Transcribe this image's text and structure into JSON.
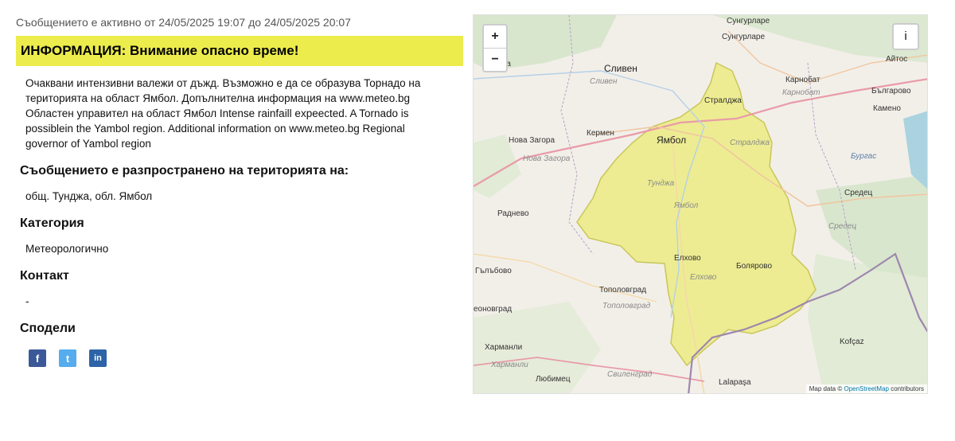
{
  "alert": {
    "active_line": "Съобщението е активно от 24/05/2025 19:07 до 24/05/2025 20:07",
    "title": "ИНФОРМАЦИЯ: Внимание опасно време!",
    "description": "Очаквани интензивни валежи от дъжд. Възможно е да се образува Торнадо на територията на област Ямбол. Допълнителна информация на www.meteo.bg Областен управител на област Ямбол Intense rainfaill expeected. A Tornado is possiblein the Yambol region. Additional information on www.meteo.bg Regional governor of Yambol region",
    "banner_color": "#ecec4c"
  },
  "sections": {
    "territory_heading": "Съобщението е разпространено на територията на:",
    "territory_value": "общ. Тунджа, обл. Ямбол",
    "category_heading": "Категория",
    "category_value": "Метеорологично",
    "contact_heading": "Контакт",
    "contact_value": "-",
    "share_heading": "Сподели"
  },
  "share": {
    "facebook": "f",
    "twitter": "t",
    "linkedin": "in"
  },
  "map": {
    "zoom_in": "+",
    "zoom_out": "−",
    "info": "i",
    "attribution_prefix": "Map data ©",
    "attribution_link": "OpenStreetMap",
    "attribution_suffix": "contributors",
    "region_color": "#eceb82",
    "labels": {
      "sungurlare_top": "Сунгурларе",
      "sungurlare": "Сунгурларе",
      "aytos": "Айтос",
      "sliven": "Сливен",
      "sliven_region": "Сливен",
      "karnobat": "Карнобат",
      "karnobat_region": "Карнобат",
      "balgarovo": "Българово",
      "kameno": "Камено",
      "stralzha": "Стралджа",
      "stralzha_region": "Стралджа",
      "nova_zagora": "Нова Загора",
      "nova_zagora_region": "Нова Загора",
      "kermen": "Кермен",
      "yambol": "Ямбол",
      "yambol_region": "Ямбол",
      "tundzha": "Тунджа",
      "burgas": "Бургас",
      "sredets": "Средец",
      "sredets_region": "Средец",
      "radnevo": "Раднево",
      "elhovo": "Елхово",
      "elhovo_region": "Елхово",
      "bolyarovo": "Болярово",
      "galabovo": "Гълъбово",
      "topolovgrad": "Тополовград",
      "topolovgrad_region": "Тополовград",
      "dimitrovgrad": "еоновград",
      "harmanli": "Харманли",
      "harmanli_region": "Харманли",
      "svilengrad": "Свиленград",
      "lyubimets": "Любимец",
      "kofcaz": "Kofçaz",
      "lalapasa": "Lalapaşa",
      "sitsa": "ица"
    }
  }
}
